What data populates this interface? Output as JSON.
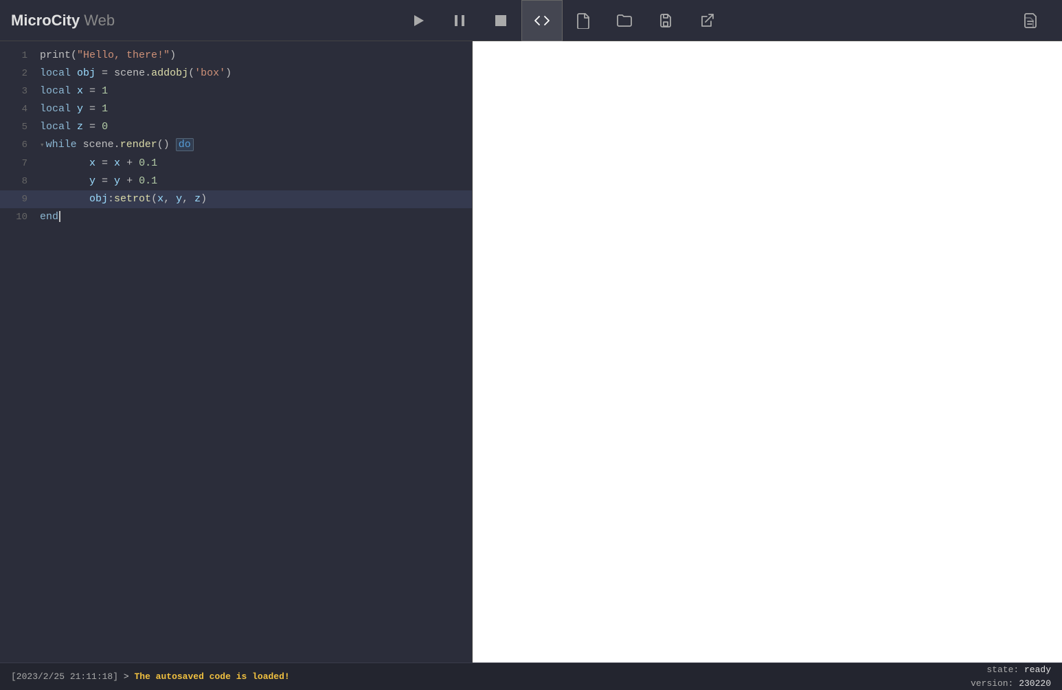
{
  "app": {
    "name_bold": "MicroCity",
    "name_light": "Web"
  },
  "toolbar": {
    "buttons": [
      {
        "id": "run",
        "label": "Run",
        "icon": "play"
      },
      {
        "id": "pause",
        "label": "Pause",
        "icon": "pause"
      },
      {
        "id": "stop",
        "label": "Stop",
        "icon": "stop"
      },
      {
        "id": "code",
        "label": "Code Editor",
        "icon": "code",
        "active": true
      },
      {
        "id": "new",
        "label": "New",
        "icon": "file"
      },
      {
        "id": "open",
        "label": "Open",
        "icon": "folder"
      },
      {
        "id": "save",
        "label": "Save",
        "icon": "save"
      },
      {
        "id": "export",
        "label": "Export",
        "icon": "export"
      },
      {
        "id": "files",
        "label": "Files",
        "icon": "files"
      }
    ]
  },
  "editor": {
    "lines": [
      {
        "num": 1,
        "tokens": [
          {
            "type": "fn",
            "text": "print"
          },
          {
            "type": "op",
            "text": "("
          },
          {
            "type": "str",
            "text": "\"Hello, there!\""
          },
          {
            "type": "op",
            "text": ")"
          }
        ]
      },
      {
        "num": 2,
        "tokens": [
          {
            "type": "kw",
            "text": "local"
          },
          {
            "type": "op",
            "text": " "
          },
          {
            "type": "ident",
            "text": "obj"
          },
          {
            "type": "op",
            "text": " = "
          },
          {
            "type": "fn",
            "text": "scene"
          },
          {
            "type": "op",
            "text": "."
          },
          {
            "type": "method",
            "text": "addobj"
          },
          {
            "type": "op",
            "text": "("
          },
          {
            "type": "str",
            "text": "'box'"
          },
          {
            "type": "op",
            "text": ")"
          }
        ]
      },
      {
        "num": 3,
        "tokens": [
          {
            "type": "kw",
            "text": "local"
          },
          {
            "type": "op",
            "text": " "
          },
          {
            "type": "ident",
            "text": "x"
          },
          {
            "type": "op",
            "text": " = "
          },
          {
            "type": "num",
            "text": "1"
          }
        ]
      },
      {
        "num": 4,
        "tokens": [
          {
            "type": "kw",
            "text": "local"
          },
          {
            "type": "op",
            "text": " "
          },
          {
            "type": "ident",
            "text": "y"
          },
          {
            "type": "op",
            "text": " = "
          },
          {
            "type": "num",
            "text": "1"
          }
        ]
      },
      {
        "num": 5,
        "tokens": [
          {
            "type": "kw",
            "text": "local"
          },
          {
            "type": "op",
            "text": " "
          },
          {
            "type": "ident",
            "text": "z"
          },
          {
            "type": "op",
            "text": " = "
          },
          {
            "type": "num",
            "text": "0"
          }
        ]
      },
      {
        "num": 6,
        "tokens": [
          {
            "type": "kw",
            "text": "while"
          },
          {
            "type": "op",
            "text": " "
          },
          {
            "type": "fn",
            "text": "scene"
          },
          {
            "type": "op",
            "text": "."
          },
          {
            "type": "method",
            "text": "render"
          },
          {
            "type": "op",
            "text": "() "
          },
          {
            "type": "kw-do",
            "text": "do"
          }
        ],
        "collapsible": true
      },
      {
        "num": 7,
        "tokens": [
          {
            "type": "op",
            "text": "    "
          },
          {
            "type": "ident",
            "text": "x"
          },
          {
            "type": "op",
            "text": " = "
          },
          {
            "type": "ident",
            "text": "x"
          },
          {
            "type": "op",
            "text": " + "
          },
          {
            "type": "num",
            "text": "0.1"
          }
        ],
        "indent": true
      },
      {
        "num": 8,
        "tokens": [
          {
            "type": "op",
            "text": "    "
          },
          {
            "type": "ident",
            "text": "y"
          },
          {
            "type": "op",
            "text": " = "
          },
          {
            "type": "ident",
            "text": "y"
          },
          {
            "type": "op",
            "text": " + "
          },
          {
            "type": "num",
            "text": "0.1"
          }
        ],
        "indent": true
      },
      {
        "num": 9,
        "tokens": [
          {
            "type": "op",
            "text": "    "
          },
          {
            "type": "ident",
            "text": "obj"
          },
          {
            "type": "op",
            "text": ":"
          },
          {
            "type": "method",
            "text": "setrot"
          },
          {
            "type": "op",
            "text": "("
          },
          {
            "type": "ident",
            "text": "x"
          },
          {
            "type": "op",
            "text": ", "
          },
          {
            "type": "ident",
            "text": "y"
          },
          {
            "type": "op",
            "text": ", "
          },
          {
            "type": "ident",
            "text": "z"
          },
          {
            "type": "op",
            "text": ")"
          }
        ],
        "indent": true,
        "selected": true
      },
      {
        "num": 10,
        "tokens": [
          {
            "type": "kw",
            "text": "end"
          }
        ],
        "cursor": true
      }
    ]
  },
  "statusbar": {
    "timestamp": "[2023/2/25 21:11:18]",
    "arrow": ">",
    "message": "The autosaved code is loaded!",
    "state_label": "state:",
    "state_value": "ready",
    "version_label": "version:",
    "version_value": "230220"
  }
}
